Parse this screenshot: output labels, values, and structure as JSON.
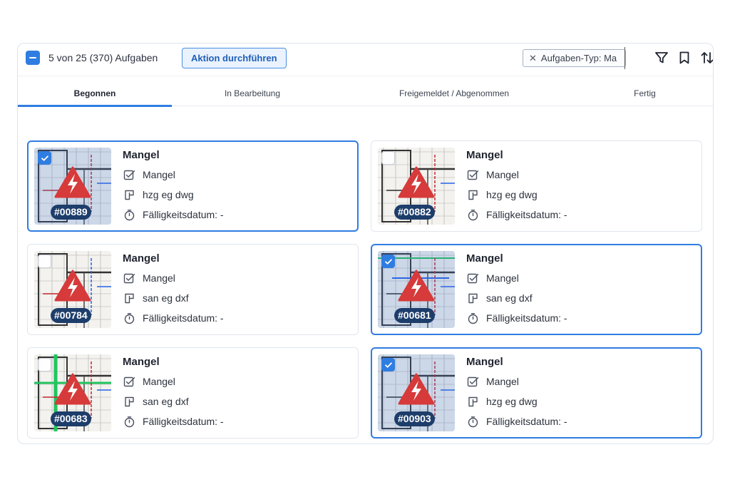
{
  "toolbar": {
    "count_text": "5 von 25 (370) Aufgaben",
    "action_label": "Aktion durchführen",
    "filter_label": "Aufgaben-Typ: Ma",
    "icons": [
      "filter-icon",
      "bookmark-icon",
      "sort-icon"
    ]
  },
  "tabs": [
    {
      "label": "Begonnen",
      "active": true
    },
    {
      "label": "In Bearbeitung",
      "active": false
    },
    {
      "label": "Freigemeldet / Abgenommen",
      "active": false
    },
    {
      "label": "Fertig",
      "active": false
    }
  ],
  "colors": {
    "accent": "#2f7de1",
    "warning_red": "#d63a3a",
    "tag_bg": "#1d3d6b"
  },
  "cards": [
    {
      "id": "#00889",
      "title": "Mangel",
      "type": "Mangel",
      "plan": "hzg eg dwg",
      "due": "Fälligkeitsdatum: -",
      "selected": true
    },
    {
      "id": "#00882",
      "title": "Mangel",
      "type": "Mangel",
      "plan": "hzg eg dwg",
      "due": "Fälligkeitsdatum: -",
      "selected": false
    },
    {
      "id": "#00784",
      "title": "Mangel",
      "type": "Mangel",
      "plan": "san eg dxf",
      "due": "Fälligkeitsdatum: -",
      "selected": false
    },
    {
      "id": "#00681",
      "title": "Mangel",
      "type": "Mangel",
      "plan": "san eg dxf",
      "due": "Fälligkeitsdatum: -",
      "selected": true
    },
    {
      "id": "#00683",
      "title": "Mangel",
      "type": "Mangel",
      "plan": "san eg dxf",
      "due": "Fälligkeitsdatum: -",
      "selected": false
    },
    {
      "id": "#00903",
      "title": "Mangel",
      "type": "Mangel",
      "plan": "hzg eg dwg",
      "due": "Fälligkeitsdatum: -",
      "selected": true
    }
  ]
}
